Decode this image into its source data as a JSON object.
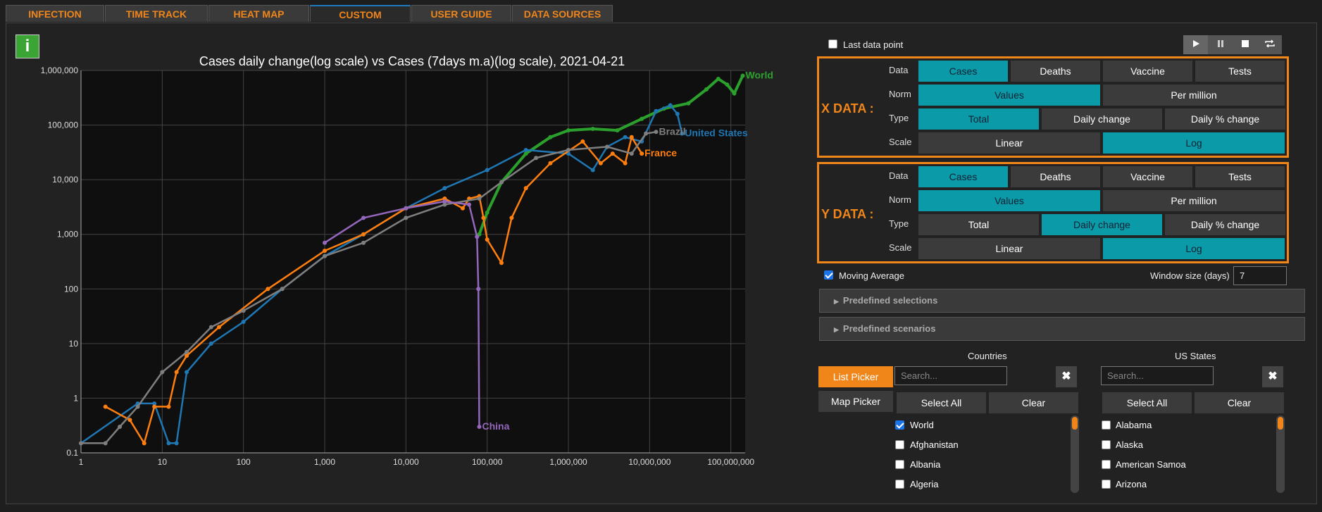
{
  "tabs": [
    {
      "label": "INFECTION MAPS",
      "active": false
    },
    {
      "label": "TIME TRACK",
      "active": false
    },
    {
      "label": "HEAT MAP",
      "active": false
    },
    {
      "label": "CUSTOM GRAPH",
      "active": true
    },
    {
      "label": "USER GUIDE",
      "active": false
    },
    {
      "label": "DATA SOURCES",
      "active": false
    }
  ],
  "info_button": "i",
  "chart_title": "Cases daily change(log scale) vs Cases (7days m.a)(log scale), 2021-04-21",
  "chart_data": {
    "type": "line",
    "title": "Cases daily change(log scale) vs Cases (7days m.a)(log scale), 2021-04-21",
    "x_scale": "log",
    "y_scale": "log",
    "xlim": [
      1,
      150000000
    ],
    "ylim": [
      0.1,
      1000000
    ],
    "x_ticks": [
      "1",
      "10",
      "100",
      "1,000",
      "10,000",
      "100,000",
      "1,000,000",
      "10,000,000",
      "100,000,000"
    ],
    "y_ticks": [
      "0.1",
      "1",
      "10",
      "100",
      "1,000",
      "10,000",
      "100,000",
      "1,000,000"
    ],
    "grid": true,
    "series": [
      {
        "name": "World",
        "color": "#2ca02c",
        "points": [
          [
            80000,
            1000
          ],
          [
            100000,
            2500
          ],
          [
            150000,
            9000
          ],
          [
            300000,
            30000
          ],
          [
            600000,
            60000
          ],
          [
            1000000,
            80000
          ],
          [
            2000000,
            85000
          ],
          [
            4000000,
            80000
          ],
          [
            8000000,
            130000
          ],
          [
            15000000,
            200000
          ],
          [
            30000000,
            250000
          ],
          [
            50000000,
            450000
          ],
          [
            70000000,
            700000
          ],
          [
            90000000,
            550000
          ],
          [
            110000000,
            380000
          ],
          [
            140000000,
            800000
          ]
        ]
      },
      {
        "name": "United States",
        "color": "#1f77b4",
        "points": [
          [
            1,
            0.15
          ],
          [
            5,
            0.8
          ],
          [
            8,
            0.8
          ],
          [
            12,
            0.15
          ],
          [
            15,
            0.15
          ],
          [
            20,
            3
          ],
          [
            40,
            10
          ],
          [
            100,
            25
          ],
          [
            300,
            100
          ],
          [
            1000,
            400
          ],
          [
            3000,
            1000
          ],
          [
            10000,
            3000
          ],
          [
            30000,
            7000
          ],
          [
            100000,
            15000
          ],
          [
            300000,
            35000
          ],
          [
            1000000,
            30000
          ],
          [
            2000000,
            15000
          ],
          [
            3000000,
            40000
          ],
          [
            5000000,
            60000
          ],
          [
            8000000,
            50000
          ],
          [
            12000000,
            180000
          ],
          [
            18000000,
            230000
          ],
          [
            22000000,
            160000
          ],
          [
            25000000,
            70000
          ]
        ]
      },
      {
        "name": "France",
        "color": "#ff7f0e",
        "points": [
          [
            2,
            0.7
          ],
          [
            4,
            0.4
          ],
          [
            6,
            0.15
          ],
          [
            8,
            0.7
          ],
          [
            12,
            0.7
          ],
          [
            15,
            3
          ],
          [
            20,
            6
          ],
          [
            50,
            20
          ],
          [
            200,
            100
          ],
          [
            1000,
            500
          ],
          [
            3000,
            1000
          ],
          [
            10000,
            3000
          ],
          [
            30000,
            4500
          ],
          [
            50000,
            3000
          ],
          [
            60000,
            4500
          ],
          [
            80000,
            5000
          ],
          [
            90000,
            2000
          ],
          [
            100000,
            800
          ],
          [
            150000,
            300
          ],
          [
            200000,
            2000
          ],
          [
            300000,
            7000
          ],
          [
            600000,
            20000
          ],
          [
            1500000,
            50000
          ],
          [
            2500000,
            20000
          ],
          [
            3500000,
            30000
          ],
          [
            5000000,
            20000
          ],
          [
            6000000,
            60000
          ],
          [
            8000000,
            30000
          ]
        ]
      },
      {
        "name": "Brazil",
        "color": "#7f7f7f",
        "points": [
          [
            1,
            0.15
          ],
          [
            2,
            0.15
          ],
          [
            3,
            0.3
          ],
          [
            5,
            0.7
          ],
          [
            10,
            3
          ],
          [
            20,
            7
          ],
          [
            40,
            20
          ],
          [
            100,
            40
          ],
          [
            300,
            100
          ],
          [
            1000,
            400
          ],
          [
            3000,
            700
          ],
          [
            10000,
            2000
          ],
          [
            30000,
            3500
          ],
          [
            80000,
            4500
          ],
          [
            150000,
            9000
          ],
          [
            400000,
            25000
          ],
          [
            1000000,
            35000
          ],
          [
            3000000,
            40000
          ],
          [
            6000000,
            30000
          ],
          [
            9000000,
            70000
          ],
          [
            12000000,
            75000
          ]
        ]
      },
      {
        "name": "China",
        "color": "#9467bd",
        "points": [
          [
            1000,
            700
          ],
          [
            3000,
            2000
          ],
          [
            10000,
            3000
          ],
          [
            30000,
            4000
          ],
          [
            60000,
            3500
          ],
          [
            75000,
            900
          ],
          [
            78000,
            100
          ],
          [
            80000,
            0.3
          ]
        ]
      }
    ]
  },
  "chart_labels": [
    {
      "text": "World",
      "color": "#2ca02c"
    },
    {
      "text": "United States",
      "color": "#1f77b4"
    },
    {
      "text": "France",
      "color": "#ff7f0e"
    },
    {
      "text": "Brazil",
      "color": "#7f7f7f"
    },
    {
      "text": "China",
      "color": "#9467bd"
    }
  ],
  "last_data_point_label": "Last data point",
  "playback": [
    "play",
    "pause",
    "stop",
    "repeat"
  ],
  "x_data": {
    "label": "X DATA :",
    "data_label": "Data",
    "data_options": [
      "Cases",
      "Deaths",
      "Vaccine",
      "Tests"
    ],
    "data_selected": 0,
    "norm_label": "Norm",
    "norm_options": [
      "Values",
      "Per million"
    ],
    "norm_selected": 0,
    "type_label": "Type",
    "type_options": [
      "Total",
      "Daily change",
      "Daily % change"
    ],
    "type_selected": 0,
    "scale_label": "Scale",
    "scale_options": [
      "Linear",
      "Log"
    ],
    "scale_selected": 1
  },
  "y_data": {
    "label": "Y DATA :",
    "data_label": "Data",
    "data_options": [
      "Cases",
      "Deaths",
      "Vaccine",
      "Tests"
    ],
    "data_selected": 0,
    "norm_label": "Norm",
    "norm_options": [
      "Values",
      "Per million"
    ],
    "norm_selected": 0,
    "type_label": "Type",
    "type_options": [
      "Total",
      "Daily change",
      "Daily % change"
    ],
    "type_selected": 1,
    "scale_label": "Scale",
    "scale_options": [
      "Linear",
      "Log"
    ],
    "scale_selected": 1
  },
  "moving_average_label": "Moving Average",
  "window_size_label": "Window size (days)",
  "window_size_value": "7",
  "predefined_selections": "Predefined selections",
  "predefined_scenarios": "Predefined scenarios",
  "countries": {
    "header": "Countries",
    "list_picker": "List Picker",
    "map_picker": "Map Picker",
    "search_placeholder": "Search...",
    "select_all": "Select All",
    "clear": "Clear",
    "items": [
      {
        "name": "World",
        "checked": true
      },
      {
        "name": "Afghanistan",
        "checked": false
      },
      {
        "name": "Albania",
        "checked": false
      },
      {
        "name": "Algeria",
        "checked": false
      }
    ]
  },
  "us_states": {
    "header": "US States",
    "search_placeholder": "Search...",
    "select_all": "Select All",
    "clear": "Clear",
    "items": [
      {
        "name": "Alabama",
        "checked": false
      },
      {
        "name": "Alaska",
        "checked": false
      },
      {
        "name": "American Samoa",
        "checked": false
      },
      {
        "name": "Arizona",
        "checked": false
      }
    ]
  }
}
